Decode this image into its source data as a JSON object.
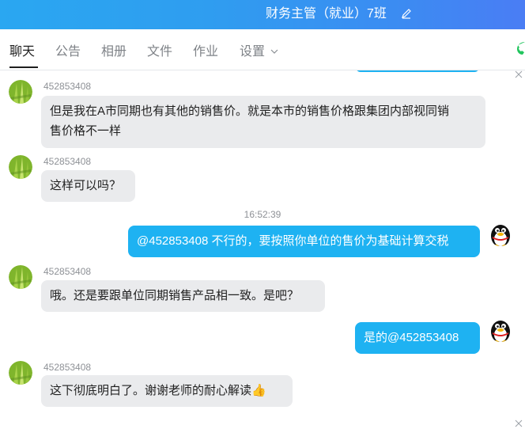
{
  "window": {
    "title": "财务主管（就业）7班",
    "icons": {
      "edit": "edit-icon",
      "phone": "phone-icon",
      "dropdown": "chevron-down-icon"
    }
  },
  "tabs": [
    {
      "label": "聊天",
      "active": true
    },
    {
      "label": "公告",
      "active": false
    },
    {
      "label": "相册",
      "active": false
    },
    {
      "label": "文件",
      "active": false
    },
    {
      "label": "作业",
      "active": false
    },
    {
      "label": "设置",
      "active": false
    }
  ],
  "messages": [
    {
      "sender": "452853408",
      "text_line1": "但是我在A市同期也有其他的销售价。就是本市的销售价格跟集团内部视同销",
      "text_line2": "售价格不一样"
    },
    {
      "sender": "452853408",
      "text": "这样可以吗？"
    },
    {
      "timestamp": "16:52:39"
    },
    {
      "self": true,
      "text": "@452853408 不行的，要按照你单位的售价为基础计算交税"
    },
    {
      "sender": "452853408",
      "text": "哦。还是要跟单位同期销售产品相一致。是吧？"
    },
    {
      "self": true,
      "text": "是的@452853408"
    },
    {
      "sender": "452853408",
      "text": "这下彻底明白了。谢谢老师的耐心解读",
      "emoji": "👍"
    }
  ],
  "colors": {
    "title_bar": "#2f9df0",
    "self_bubble": "#1eb2f2",
    "other_bubble": "#eaebed",
    "active_tab": "#1f1f1f",
    "inactive_tab": "#7e8287"
  }
}
